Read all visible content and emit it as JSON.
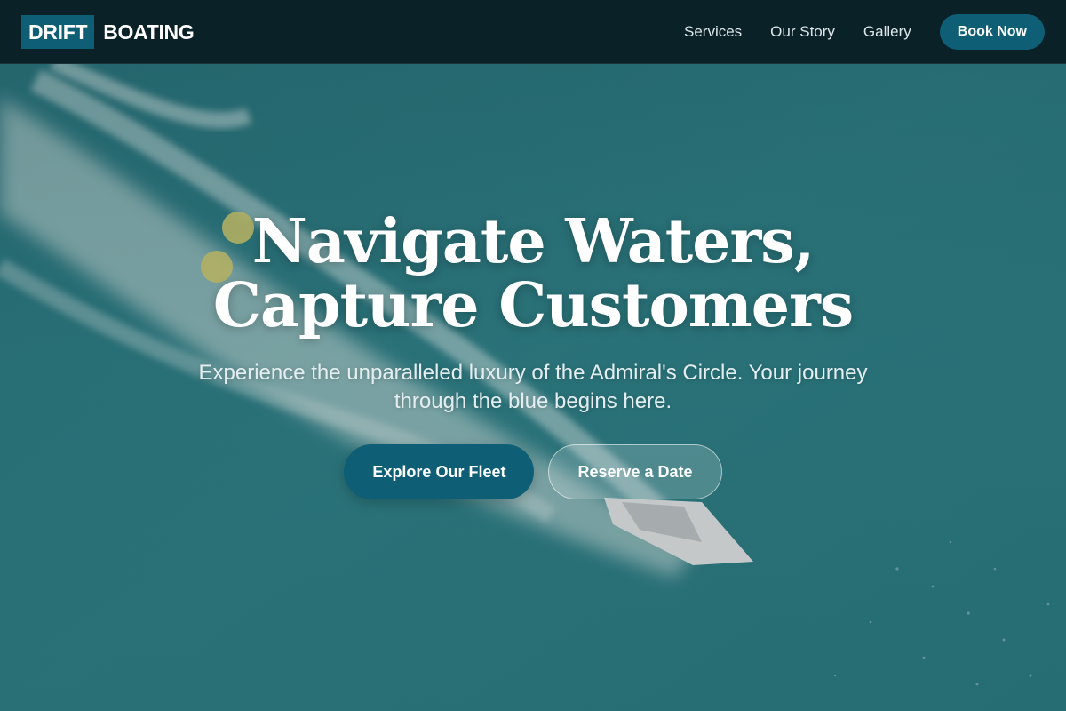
{
  "brand": {
    "boxed": "DRIFT",
    "text": "BOATING"
  },
  "nav": {
    "links": [
      "Services",
      "Our Story",
      "Gallery"
    ],
    "cta": "Book Now"
  },
  "hero": {
    "title": "Navigate Waters, Capture Customers",
    "subtitle": "Experience the unparalleled luxury of the Admiral's Circle. Your journey through the blue begins here.",
    "primary_button": "Explore Our Fleet",
    "secondary_button": "Reserve a Date",
    "background_image": "aerial-speedboat-on-teal-sea"
  },
  "colors": {
    "navbar": "#0a2128",
    "accent": "#0e5f75",
    "sea": "#2e7b81"
  }
}
